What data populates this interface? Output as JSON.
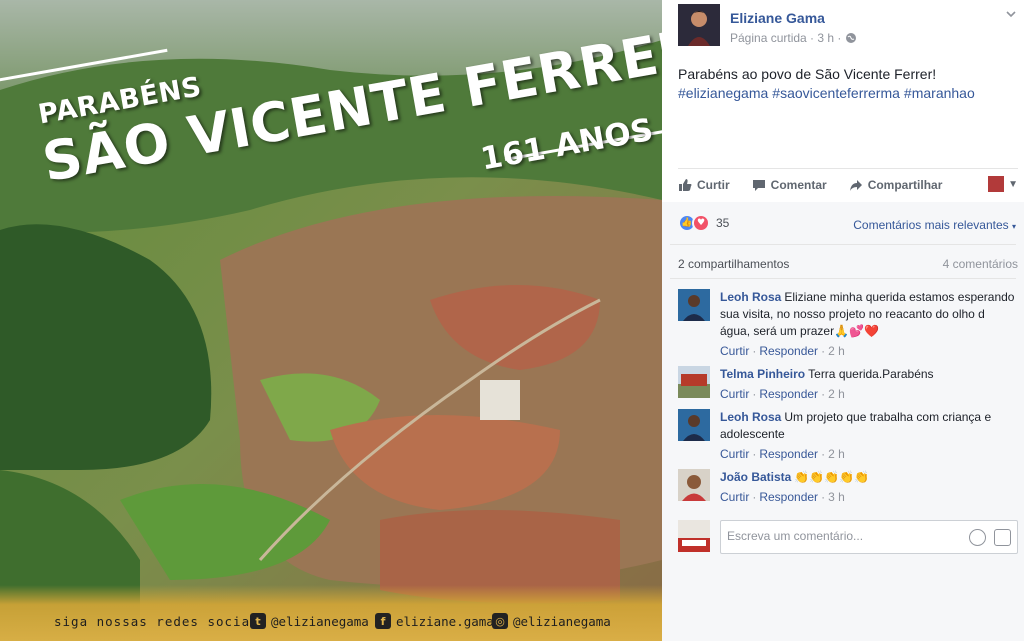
{
  "photo": {
    "banner_pre": "PARABÉNS",
    "banner_city": "SÃO VICENTE FERRER",
    "banner_years": "161 ANOS",
    "footer_tagline": "siga nossas redes sociais",
    "social": [
      {
        "icon": "twitter-icon",
        "handle": "@elizianegama"
      },
      {
        "icon": "facebook-icon",
        "handle": "eliziane.gama"
      },
      {
        "icon": "instagram-icon",
        "handle": "@elizianegama"
      }
    ]
  },
  "post": {
    "author": "Eliziane Gama",
    "meta": "Página curtida · 3 h ·",
    "text": "Parabéns ao povo de São Vicente Ferrer!",
    "hashtags": [
      "#elizianegama",
      "#saovicenteferrerma",
      "#maranhao"
    ]
  },
  "actions": {
    "like": "Curtir",
    "comment": "Comentar",
    "share": "Compartilhar"
  },
  "reactions": {
    "count": "35",
    "sort_label": "Comentários mais relevantes"
  },
  "stats": {
    "shares": "2 compartilhamentos",
    "comments": "4 comentários"
  },
  "comments": [
    {
      "author": "Leoh Rosa",
      "text": "Eliziane minha querida estamos esperando sua visita, no nosso projeto no reacanto do olho d água, será um prazer🙏💕❤️",
      "reply_like": "Curtir",
      "reply": "Responder",
      "time": "2 h"
    },
    {
      "author": "Telma Pinheiro",
      "text": "Terra querida.Parabéns",
      "reply_like": "Curtir",
      "reply": "Responder",
      "time": "2 h"
    },
    {
      "author": "Leoh Rosa",
      "text": "Um projeto que trabalha com criança e adolescente",
      "reply_like": "Curtir",
      "reply": "Responder",
      "time": "2 h"
    },
    {
      "author": "João Batista",
      "text": "👏👏👏👏👏",
      "reply_like": "Curtir",
      "reply": "Responder",
      "time": "3 h"
    }
  ],
  "writer": {
    "placeholder": "Escreva um comentário..."
  },
  "colors": {
    "link": "#365899",
    "muted": "#90949c",
    "panel": "#f6f7f9",
    "like_reaction": "#4d87f4",
    "love_reaction": "#f25268"
  }
}
